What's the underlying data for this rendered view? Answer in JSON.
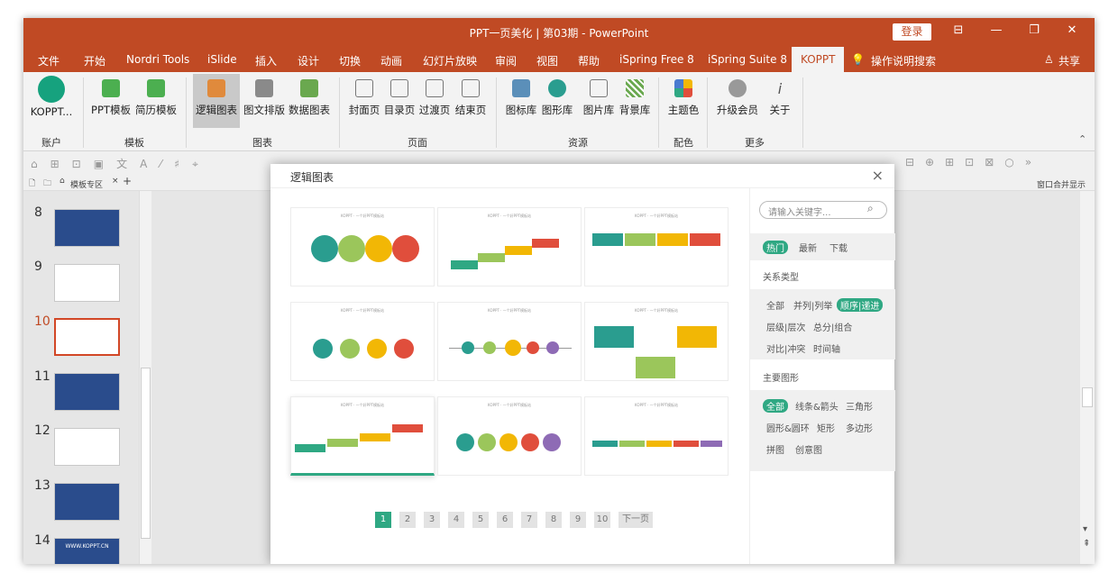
{
  "window": {
    "title": "PPT一页美化 | 第03期  -  PowerPoint",
    "login": "登录",
    "share": "共享"
  },
  "menu": [
    "文件",
    "开始",
    "Nordri Tools",
    "iSlide",
    "插入",
    "设计",
    "切换",
    "动画",
    "幻灯片放映",
    "审阅",
    "视图",
    "帮助",
    "iSpring Free 8",
    "iSpring Suite 8",
    "KOPPT",
    "操作说明搜索"
  ],
  "ribbon": {
    "buttons": [
      "KOPPT...",
      "PPT模板",
      "简历模板",
      "逻辑图表",
      "图文排版",
      "数据图表",
      "封面页",
      "目录页",
      "过渡页",
      "结束页",
      "图标库",
      "图形库",
      "图片库",
      "背景库",
      "主题色",
      "升级会员",
      "关于"
    ],
    "groups": [
      "账户",
      "模板",
      "图表",
      "页面",
      "资源",
      "配色",
      "更多"
    ]
  },
  "tabs": {
    "template_zone": "模板专区",
    "window_merge": "窗口合并显示"
  },
  "slides": [
    {
      "num": "8"
    },
    {
      "num": "9"
    },
    {
      "num": "10"
    },
    {
      "num": "11"
    },
    {
      "num": "12"
    },
    {
      "num": "13"
    },
    {
      "num": "14"
    }
  ],
  "thumb14_text": "WWW.KOPPT.CN",
  "dialog": {
    "title": "逻辑图表",
    "close": "×",
    "card_caption": "KOPPT · 一个好PPT模板站",
    "pages": [
      "1",
      "2",
      "3",
      "4",
      "5",
      "6",
      "7",
      "8",
      "9",
      "10"
    ],
    "next": "下一页",
    "search_placeholder": "请输入关键字...",
    "sort": [
      "热门",
      "最新",
      "下载"
    ],
    "relation_title": "关系类型",
    "relation": [
      "全部",
      "并列|列举",
      "顺序|递进",
      "层级|层次",
      "总分|组合",
      "对比|冲突",
      "时间轴"
    ],
    "shape_title": "主要图形",
    "shape": [
      "全部",
      "线条&箭头",
      "三角形",
      "圆形&圆环",
      "矩形",
      "多边形",
      "拼图",
      "创意图"
    ]
  },
  "colors": {
    "accent": "#c04a24",
    "green": "#2fa883",
    "teal": "#2a9d8f",
    "yellow": "#f2b705",
    "orange": "#f0843c",
    "red": "#e04e3c",
    "purple": "#8e6bb5",
    "lime": "#9bc65b"
  }
}
